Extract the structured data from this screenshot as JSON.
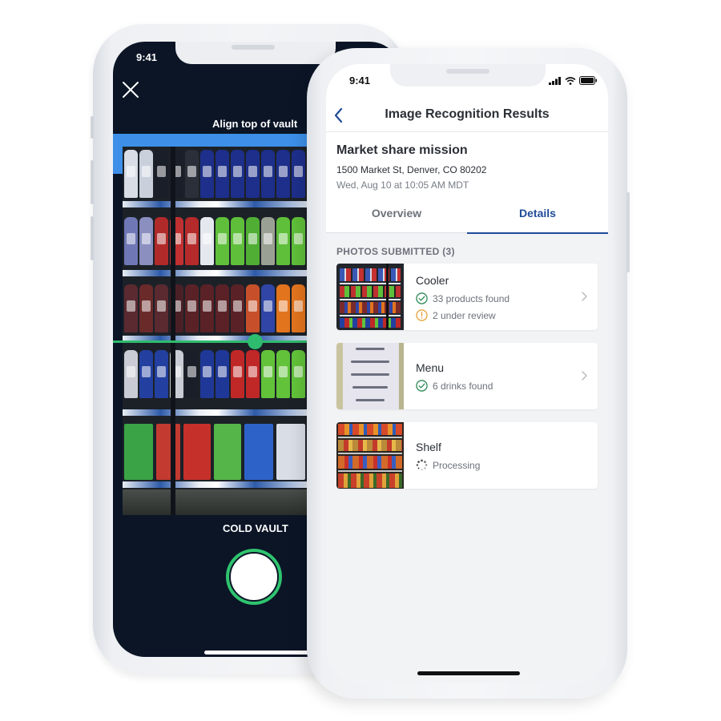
{
  "camera_screen": {
    "time": "9:41",
    "close_icon": "close-icon",
    "align_label": "Align top of vault",
    "section_label": "COLD VAULT",
    "shutter_icon": "shutter-button",
    "guide_color": "#2ebc6e",
    "background_color": "#0b1526"
  },
  "results_screen": {
    "time": "9:41",
    "status_icons": [
      "signal-icon",
      "wifi-icon",
      "battery-icon"
    ],
    "nav": {
      "back_icon": "chevron-left-icon",
      "title": "Image Recognition Results"
    },
    "mission": {
      "title": "Market share mission",
      "address": "1500 Market St, Denver, CO 80202",
      "date": "Wed, Aug 10 at 10:05 AM MDT"
    },
    "tabs": [
      {
        "label": "Overview",
        "active": false
      },
      {
        "label": "Details",
        "active": true
      }
    ],
    "section_label": "PHOTOS SUBMITTED (3)",
    "photos": [
      {
        "title": "Cooler",
        "thumbnail": "cooler-photo",
        "lines": [
          {
            "icon": "check-circle-icon",
            "text": "33 products found",
            "color": "#2e8b57"
          },
          {
            "icon": "warning-circle-icon",
            "text": "2 under review",
            "color": "#e8a33d"
          }
        ],
        "has_chevron": true
      },
      {
        "title": "Menu",
        "thumbnail": "menu-photo",
        "lines": [
          {
            "icon": "check-circle-icon",
            "text": "6 drinks found",
            "color": "#2e8b57"
          }
        ],
        "has_chevron": true
      },
      {
        "title": "Shelf",
        "thumbnail": "shelf-photo",
        "lines": [
          {
            "icon": "spinner-icon",
            "text": "Processing",
            "color": "#6c717a"
          }
        ],
        "has_chevron": false
      }
    ],
    "accent_color": "#1f4b99"
  }
}
